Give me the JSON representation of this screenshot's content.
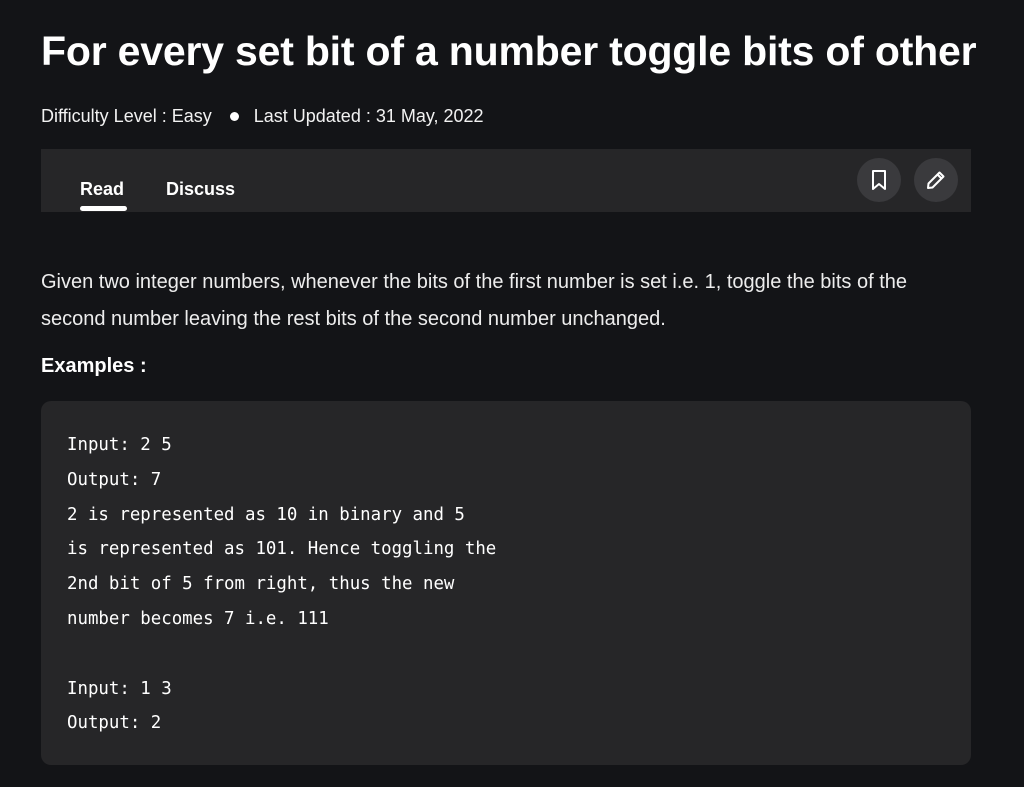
{
  "article": {
    "title": "For every set bit of a number toggle bits of other",
    "difficulty": "Difficulty Level : Easy",
    "last_updated": "Last Updated : 31 May, 2022"
  },
  "tabs": {
    "read": "Read",
    "discuss": "Discuss",
    "active": "Read"
  },
  "actions": {
    "bookmark_icon": "bookmark-icon",
    "edit_icon": "pencil-icon"
  },
  "content": {
    "intro": "Given two integer numbers, whenever the bits of the first number is set i.e. 1, toggle the bits of the second number leaving the rest bits of the second number unchanged.",
    "examples_heading": "Examples :",
    "code_lines": [
      "Input: 2 5",
      "Output: 7",
      "2 is represented as 10 in binary and 5",
      "is represented as 101. Hence toggling the",
      "2nd bit of 5 from right, thus the new",
      "number becomes 7 i.e. 111",
      "",
      "Input: 1 3",
      "Output: 2"
    ]
  },
  "colors": {
    "background": "#131417",
    "panel": "#262628",
    "icon_button": "#3a3a3d",
    "text": "#ffffff"
  }
}
